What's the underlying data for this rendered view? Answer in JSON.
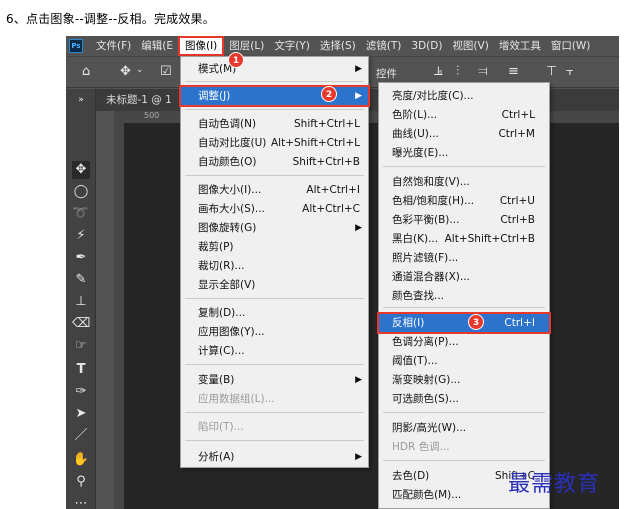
{
  "instruction": "6、点击图象--调整--反相。完成效果。",
  "app": {
    "logo": "Ps",
    "menubar": [
      "文件(F)",
      "编辑(E",
      "图像(I)",
      "图层(L)",
      "文字(Y)",
      "选择(S)",
      "滤镜(T)",
      "3D(D)",
      "视图(V)",
      "增效工具",
      "窗口(W)"
    ],
    "options_label": "控件",
    "doc_tab": "未标题-1 @ 1",
    "ruler_mark": "500"
  },
  "image_menu": [
    {
      "label": "模式(M)",
      "shortcut": "",
      "submenu": true
    },
    {
      "label": "调整(J)",
      "shortcut": "",
      "submenu": true
    },
    {
      "label": "自动色调(N)",
      "shortcut": "Shift+Ctrl+L"
    },
    {
      "label": "自动对比度(U)",
      "shortcut": "Alt+Shift+Ctrl+L"
    },
    {
      "label": "自动颜色(O)",
      "shortcut": "Shift+Ctrl+B"
    },
    {
      "label": "图像大小(I)...",
      "shortcut": "Alt+Ctrl+I"
    },
    {
      "label": "画布大小(S)...",
      "shortcut": "Alt+Ctrl+C"
    },
    {
      "label": "图像旋转(G)",
      "shortcut": "",
      "submenu": true
    },
    {
      "label": "裁剪(P)",
      "shortcut": ""
    },
    {
      "label": "裁切(R)...",
      "shortcut": ""
    },
    {
      "label": "显示全部(V)",
      "shortcut": ""
    },
    {
      "label": "复制(D)...",
      "shortcut": ""
    },
    {
      "label": "应用图像(Y)...",
      "shortcut": ""
    },
    {
      "label": "计算(C)...",
      "shortcut": ""
    },
    {
      "label": "变量(B)",
      "shortcut": "",
      "submenu": true
    },
    {
      "label": "应用数据组(L)...",
      "shortcut": "",
      "disabled": true
    },
    {
      "label": "陷印(T)...",
      "shortcut": "",
      "disabled": true
    },
    {
      "label": "分析(A)",
      "shortcut": "",
      "submenu": true
    }
  ],
  "adjust_menu": [
    {
      "label": "亮度/对比度(C)...",
      "shortcut": ""
    },
    {
      "label": "色阶(L)...",
      "shortcut": "Ctrl+L"
    },
    {
      "label": "曲线(U)...",
      "shortcut": "Ctrl+M"
    },
    {
      "label": "曝光度(E)...",
      "shortcut": ""
    },
    {
      "label": "自然饱和度(V)...",
      "shortcut": ""
    },
    {
      "label": "色相/饱和度(H)...",
      "shortcut": "Ctrl+U"
    },
    {
      "label": "色彩平衡(B)...",
      "shortcut": "Ctrl+B"
    },
    {
      "label": "黑白(K)...",
      "shortcut": "Alt+Shift+Ctrl+B"
    },
    {
      "label": "照片滤镜(F)...",
      "shortcut": ""
    },
    {
      "label": "通道混合器(X)...",
      "shortcut": ""
    },
    {
      "label": "颜色查找...",
      "shortcut": ""
    },
    {
      "label": "反相(I)",
      "shortcut": "Ctrl+I"
    },
    {
      "label": "色调分离(P)...",
      "shortcut": ""
    },
    {
      "label": "阈值(T)...",
      "shortcut": ""
    },
    {
      "label": "渐变映射(G)...",
      "shortcut": ""
    },
    {
      "label": "可选颜色(S)...",
      "shortcut": ""
    },
    {
      "label": "阴影/高光(W)...",
      "shortcut": ""
    },
    {
      "label": "HDR 色调...",
      "shortcut": "",
      "disabled": true
    },
    {
      "label": "去色(D)",
      "shortcut": "Shift+C"
    },
    {
      "label": "匹配颜色(M)...",
      "shortcut": ""
    }
  ],
  "step_badges": [
    "1",
    "2",
    "3"
  ],
  "watermark": "最需教育",
  "colors": {
    "highlight": "#2b73cc",
    "callout": "#e8372b",
    "ps_bg": "#535353"
  }
}
